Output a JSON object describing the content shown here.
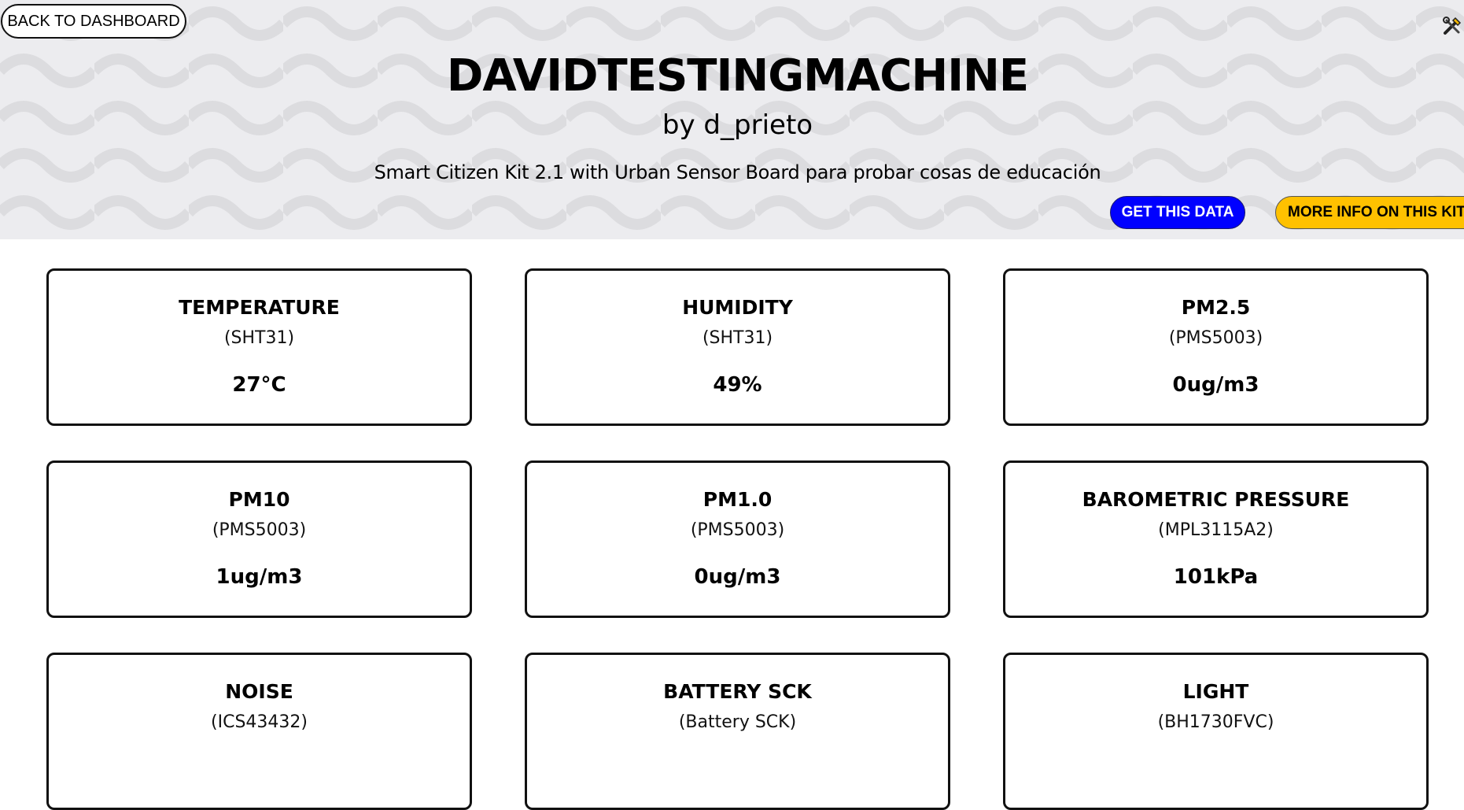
{
  "header": {
    "back_label": "BACK TO DASHBOARD",
    "title": "DAVIDTESTINGMACHINE",
    "byline": "by d_prieto",
    "description": "Smart Citizen Kit 2.1 with Urban Sensor Board para probar cosas de educación",
    "get_data_label": "GET THIS DATA",
    "more_info_label": "MORE INFO ON THIS KIT",
    "tools_icon": "tools-icon",
    "colors": {
      "hero_bg": "#ececef",
      "get_data_bg": "#0000ff",
      "more_info_bg": "#ffc100"
    }
  },
  "sensors": [
    {
      "name": "TEMPERATURE",
      "sensor": "(SHT31)",
      "value": "27°C"
    },
    {
      "name": "HUMIDITY",
      "sensor": "(SHT31)",
      "value": "49%"
    },
    {
      "name": "PM2.5",
      "sensor": "(PMS5003)",
      "value": "0ug/m3"
    },
    {
      "name": "PM10",
      "sensor": "(PMS5003)",
      "value": "1ug/m3"
    },
    {
      "name": "PM1.0",
      "sensor": "(PMS5003)",
      "value": "0ug/m3"
    },
    {
      "name": "BAROMETRIC PRESSURE",
      "sensor": "(MPL3115A2)",
      "value": "101kPa"
    },
    {
      "name": "NOISE",
      "sensor": "(ICS43432)",
      "value": ""
    },
    {
      "name": "BATTERY SCK",
      "sensor": "(Battery SCK)",
      "value": ""
    },
    {
      "name": "LIGHT",
      "sensor": "(BH1730FVC)",
      "value": ""
    }
  ]
}
